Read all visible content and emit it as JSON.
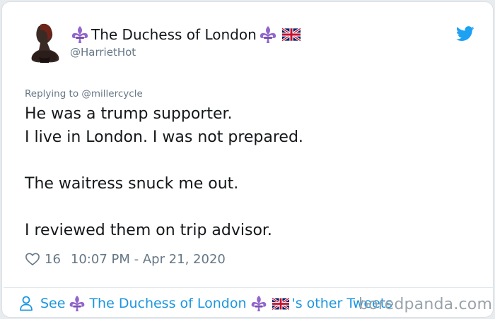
{
  "author": {
    "display_name": "The Duchess of London",
    "handle": "@HarrietHot",
    "name_emojis": [
      "fleur-de-lis-icon",
      "uk-flag-icon"
    ]
  },
  "reply": {
    "prefix": "Replying to",
    "mention": "@millercycle"
  },
  "tweet": {
    "lines": [
      "He was a trump supporter.",
      "I live in London. I was not prepared.",
      "",
      "The waitress snuck me out.",
      "",
      "I reviewed them on trip advisor."
    ]
  },
  "meta": {
    "likes": "16",
    "timestamp": "10:07 PM - Apr 21, 2020"
  },
  "footer": {
    "see": "See",
    "name": "The Duchess of London",
    "suffix": "'s other Tweets"
  },
  "watermark": "boredpanda.com",
  "colors": {
    "text": "#14171a",
    "secondary": "#657786",
    "link": "#1b95e0",
    "fleur": "#9266cc"
  }
}
